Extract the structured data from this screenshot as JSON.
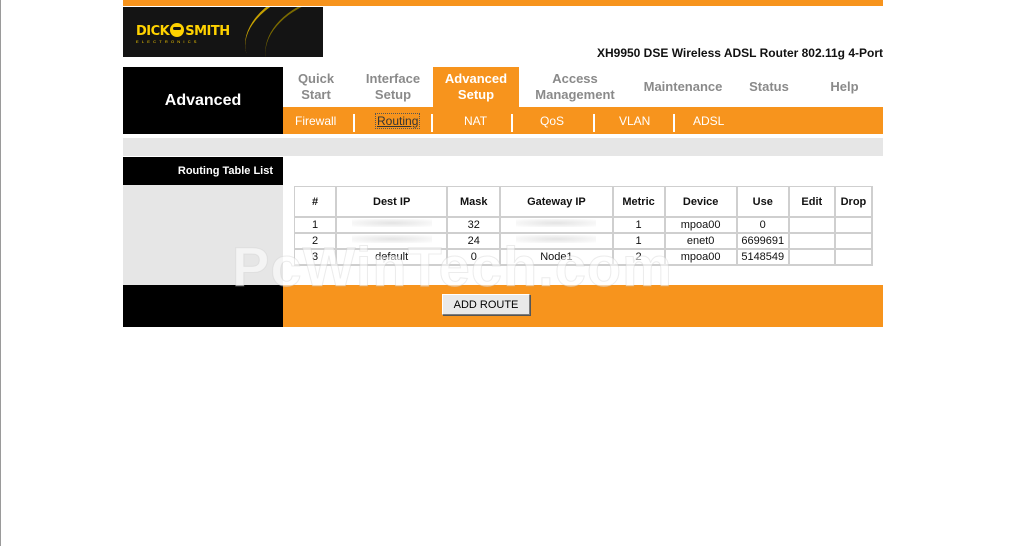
{
  "header": {
    "logo_text_left": "DICK",
    "logo_text_right": "SMITH",
    "logo_sub": "ELECTRONICS",
    "product_title": "XH9950 DSE Wireless ADSL Router 802.11g 4-Port"
  },
  "section": {
    "title": "Advanced"
  },
  "main_nav": [
    {
      "label": "Quick\nStart",
      "active": false
    },
    {
      "label": "Interface\nSetup",
      "active": false
    },
    {
      "label": "Advanced\nSetup",
      "active": true
    },
    {
      "label": "Access\nManagement",
      "active": false
    },
    {
      "label": "Maintenance",
      "active": false
    },
    {
      "label": "Status",
      "active": false
    },
    {
      "label": "Help",
      "active": false
    }
  ],
  "sub_nav": [
    "Firewall",
    "Routing",
    "NAT",
    "QoS",
    "VLAN",
    "ADSL"
  ],
  "sub_nav_active": "Routing",
  "routing": {
    "section_label": "Routing Table List",
    "columns": [
      "#",
      "Dest IP",
      "Mask",
      "Gateway IP",
      "Metric",
      "Device",
      "Use",
      "Edit",
      "Drop"
    ],
    "rows": [
      [
        "1",
        "",
        "32",
        "",
        "1",
        "mpoa00",
        "0",
        "",
        ""
      ],
      [
        "2",
        "",
        "24",
        "",
        "1",
        "enet0",
        "6699691",
        "",
        ""
      ],
      [
        "3",
        "default",
        "0",
        "Node1",
        "2",
        "mpoa00",
        "5148549",
        "",
        ""
      ]
    ],
    "add_button": "ADD ROUTE"
  },
  "watermark": "PcWinTech.com",
  "colors": {
    "accent": "#f7941d",
    "dark": "#000000",
    "panel_gray": "#e6e6e6"
  }
}
